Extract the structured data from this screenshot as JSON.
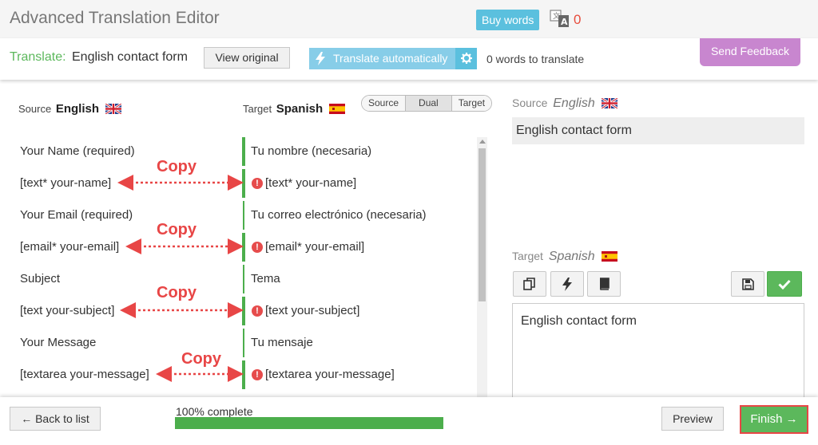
{
  "app": {
    "title": "Advanced Translation Editor",
    "buy_words_label": "Buy words",
    "credits_count": "0",
    "credits_icon": "translate-credits-icon"
  },
  "subheader": {
    "translate_label": "Translate:",
    "document_name": "English contact form",
    "view_original_label": "View original",
    "translate_auto_label": "Translate automatically",
    "words_to_translate": "0 words to translate",
    "send_feedback_label": "Send Feedback"
  },
  "columns": {
    "source_prefix": "Source",
    "source_language": "English",
    "target_prefix": "Target",
    "target_language": "Spanish",
    "view_modes": [
      "Source",
      "Dual",
      "Target"
    ]
  },
  "rows": [
    {
      "source": "Your Name (required)",
      "target": "Tu nombre (necesaria)",
      "error": false
    },
    {
      "source": "[text* your-name]",
      "target": "[text* your-name]",
      "error": true
    },
    {
      "source": "Your Email (required)",
      "target": "Tu correo electrónico (necesaria)",
      "error": false
    },
    {
      "source": "[email* your-email]",
      "target": "[email* your-email]",
      "error": true
    },
    {
      "source": "Subject",
      "target": "Tema",
      "error": false
    },
    {
      "source": "[text your-subject]",
      "target": "[text your-subject]",
      "error": true
    },
    {
      "source": "Your Message",
      "target": "Tu mensaje",
      "error": false
    },
    {
      "source": "[textarea your-message]",
      "target": "[textarea your-message]",
      "error": true
    }
  ],
  "annotations": {
    "copy_label": "Copy",
    "arrow_color": "#e84646"
  },
  "right_panel": {
    "source_label": "Source",
    "source_language": "English",
    "source_text": "English contact form",
    "target_label": "Target",
    "target_language": "Spanish",
    "target_text": "English contact form",
    "tools": [
      "copy-icon",
      "bolt-icon",
      "book-icon",
      "save-icon",
      "check-icon"
    ]
  },
  "footer": {
    "back_label": "← Back to list",
    "progress_text": "100% complete",
    "progress_value": 1.0,
    "preview_label": "Preview",
    "finish_label": "Finish →"
  },
  "colors": {
    "accent_blue": "#5bc0de",
    "success_green": "#5cb85c",
    "feedback_purple": "#c886cf",
    "error_red": "#e64c4c"
  }
}
